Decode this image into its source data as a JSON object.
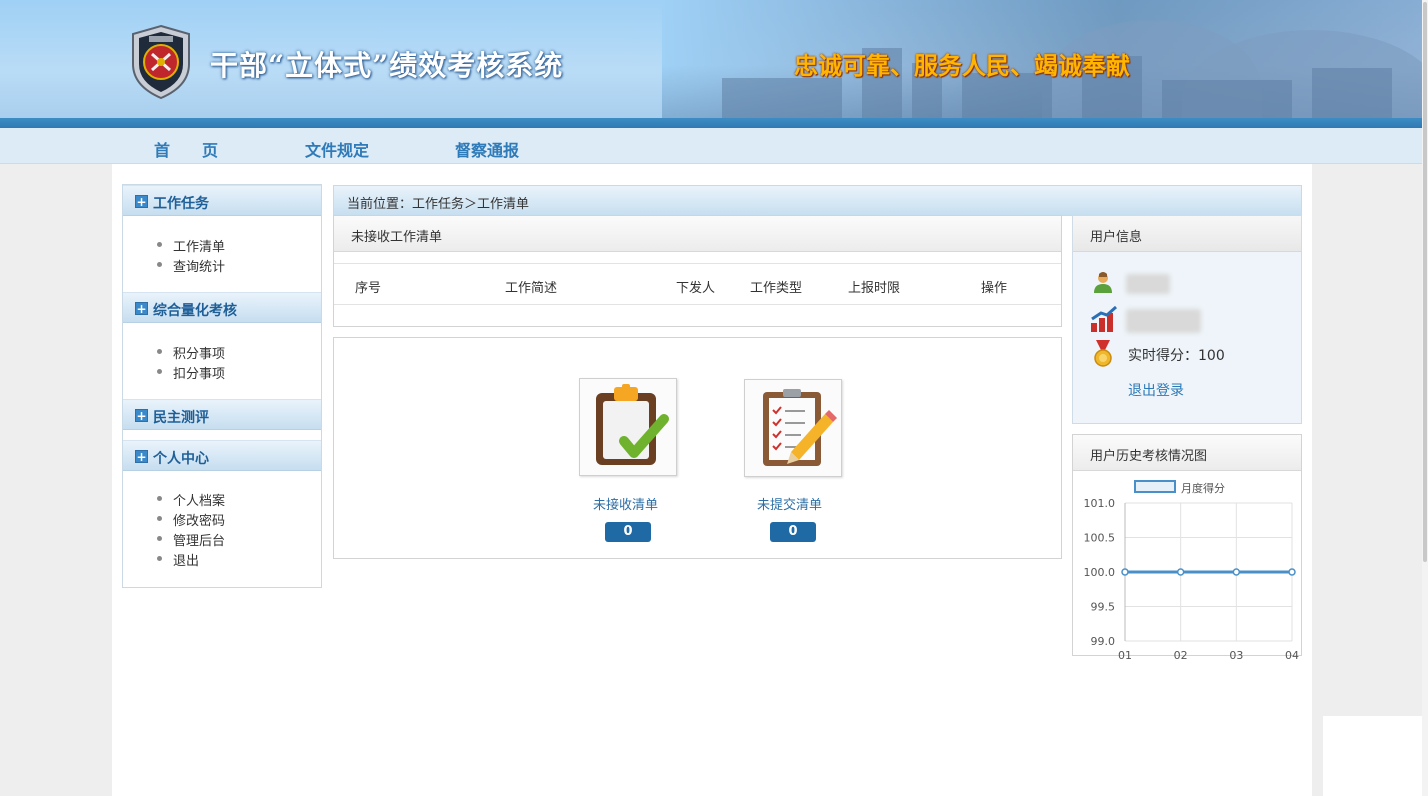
{
  "header": {
    "system_title": "干部“立体式”绩效考核系统",
    "slogan": "忠诚可靠、服务人民、竭诚奉献"
  },
  "nav": {
    "items": [
      {
        "label": "首　　页"
      },
      {
        "label": "文件规定"
      },
      {
        "label": "督察通报"
      }
    ]
  },
  "sidebar": {
    "sections": [
      {
        "title": "工作任务",
        "links": [
          "工作清单",
          "查询统计"
        ]
      },
      {
        "title": "综合量化考核",
        "links": [
          "积分事项",
          "扣分事项"
        ]
      },
      {
        "title": "民主测评",
        "links": []
      },
      {
        "title": "个人中心",
        "links": [
          "个人档案",
          "修改密码",
          "管理后台",
          "退出"
        ]
      }
    ]
  },
  "breadcrumb": "当前位置：工作任务＞工作清单",
  "task_panel": {
    "title": "未接收工作清单",
    "columns": [
      "序号",
      "工作简述",
      "下发人",
      "工作类型",
      "上报时限",
      "操作"
    ]
  },
  "stats": [
    {
      "label": "未接收清单",
      "count": "0"
    },
    {
      "label": "未提交清单",
      "count": "0"
    }
  ],
  "user_info": {
    "title": "用户信息",
    "score_label": "实时得分：100",
    "logout": "退出登录"
  },
  "history_chart": {
    "title": "用户历史考核情况图"
  },
  "chart_data": {
    "type": "line",
    "x": [
      "01",
      "02",
      "03",
      "04"
    ],
    "series": [
      {
        "name": "月度得分",
        "values": [
          100.0,
          100.0,
          100.0,
          100.0
        ],
        "color": "#4a90c8"
      }
    ],
    "ylim": [
      99.0,
      101.0
    ],
    "yticks": [
      "101.0",
      "100.5",
      "100.0",
      "99.5",
      "99.0"
    ],
    "grid": true,
    "legend": "top"
  }
}
